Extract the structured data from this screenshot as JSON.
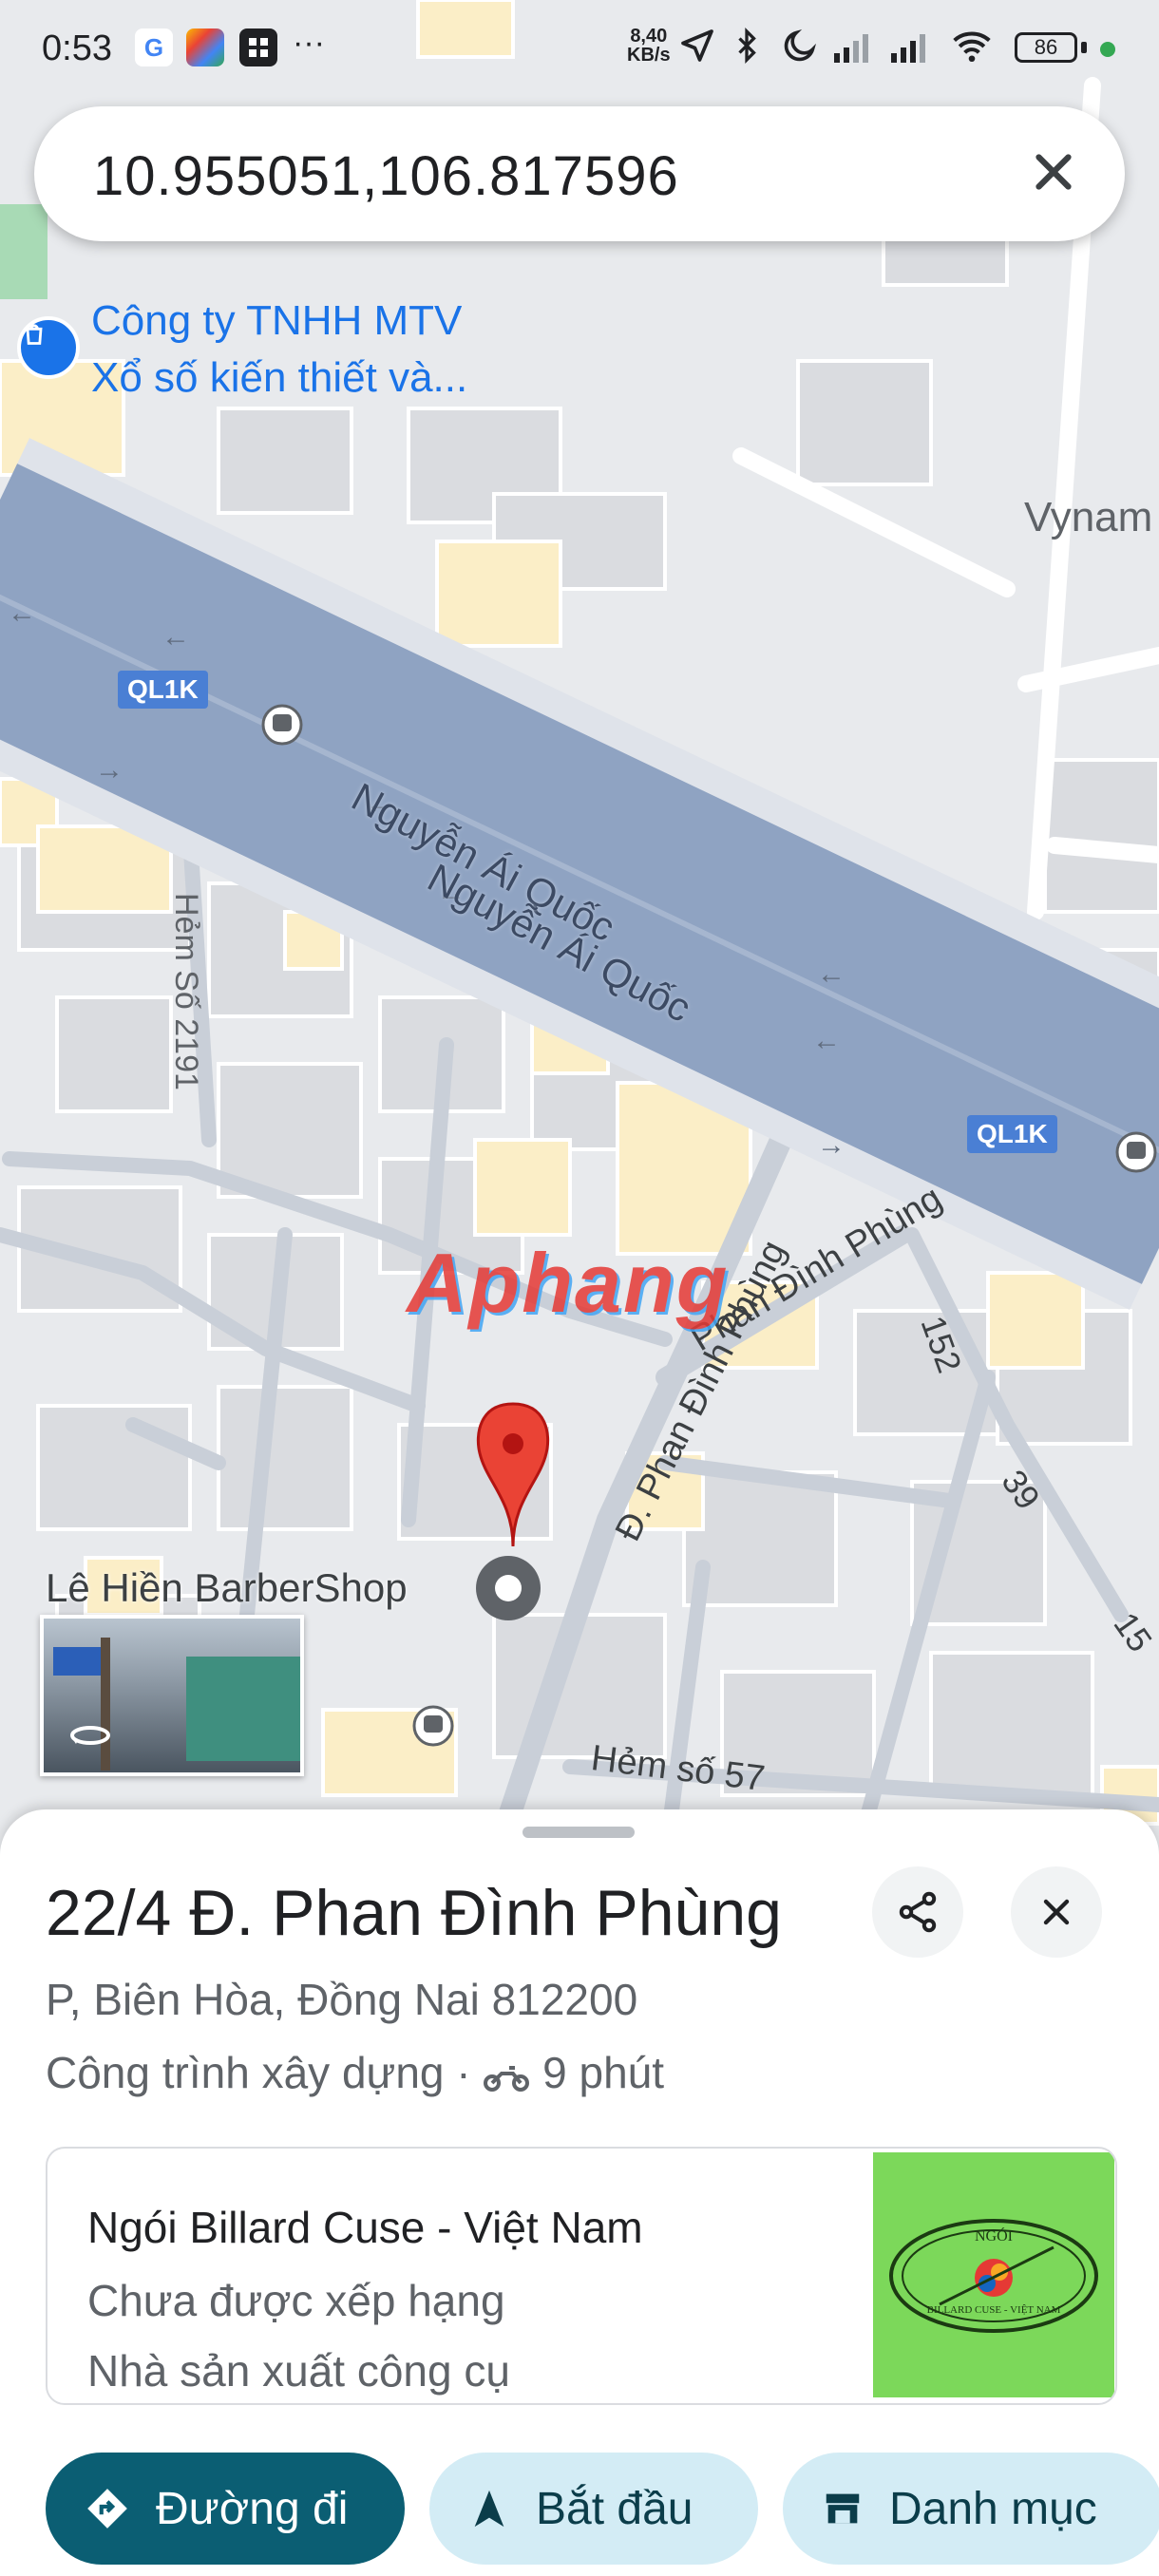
{
  "status_bar": {
    "time": "0:53",
    "app_icons": [
      "google-icon",
      "photos-icon",
      "app-icon",
      "more-icon"
    ],
    "more": "···",
    "net_speed_value": "8,40",
    "net_speed_unit": "KB/s",
    "battery": "86",
    "accent_dot_color": "#34a853"
  },
  "search": {
    "query": "10.955051,106.817596"
  },
  "map": {
    "place_label_line1": "Công ty TNHH MTV",
    "place_label_line2": "Xổ số kiến thiết và...",
    "edge_label": "Vynam",
    "road_shield_1": "QL1K",
    "road_shield_2": "QL1K",
    "road_name_1": "Nguyễn Ái Quốc",
    "road_name_2": "Nguyễn Ái Quốc",
    "alley_2191": "Hẻm Số 2191",
    "street_phan_dinh_phung_upper": "Phan Đình Phùng",
    "street_phan_dinh_phung_lower": "Đ. Phan Đình Phùng",
    "label_152": "152",
    "label_39": "39",
    "label_15": "15",
    "barbershop": "Lê Hiền BarberShop",
    "alley_57": "Hẻm số 57",
    "watermark": "Aphang",
    "colors": {
      "highway": "#8fa3c2",
      "pin": "#ea4335",
      "label_blue": "#1a73e8"
    }
  },
  "sheet": {
    "title": "22/4 Đ. Phan Đình Phùng",
    "address": "P, Biên Hòa, Đồng Nai 812200",
    "category": "Công trình xây dựng",
    "separator": "·",
    "travel_time": "9 phút",
    "card": {
      "name": "Ngói Billard Cuse - Việt Nam",
      "rating": "Chưa được xếp hạng",
      "category": "Nhà sản xuất công cụ",
      "logo_text_top": "NGÓI",
      "logo_text_bottom": "BILLARD CUSE - VIỆT NAM"
    },
    "buttons": {
      "directions": "Đường đi",
      "start": "Bắt đầu",
      "catalog": "Danh mục"
    },
    "colors": {
      "primary": "#0b5e73",
      "secondary_bg": "#d3ecf5"
    }
  }
}
